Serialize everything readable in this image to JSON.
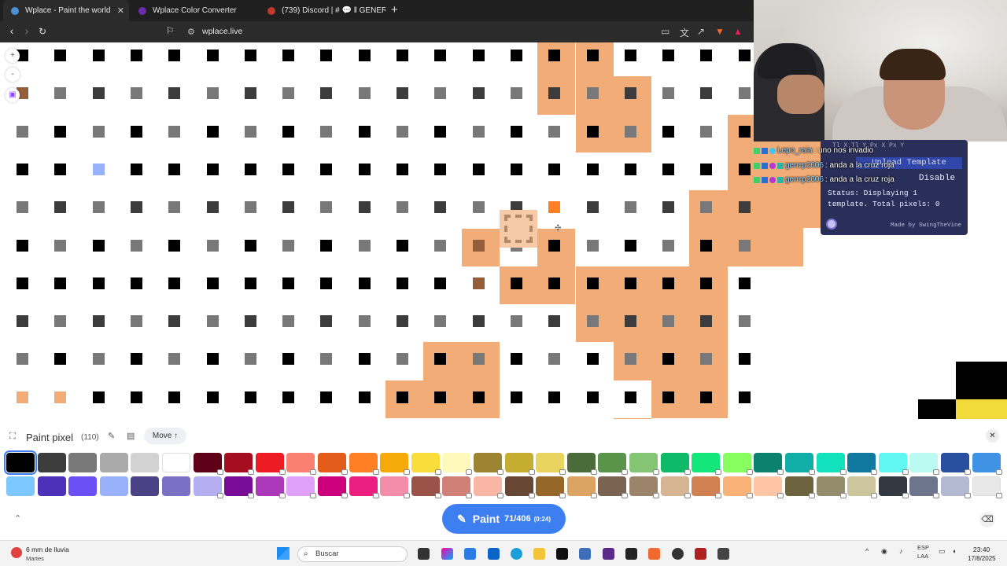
{
  "browser": {
    "tabs": [
      {
        "title": "Wplace - Paint the world",
        "active": true,
        "icon": "globe-icon"
      },
      {
        "title": "Wplace Color Converter",
        "active": false,
        "icon": "purple-dot-icon"
      },
      {
        "title": "(739) Discord | # 💬 ‖ GENERAL | Garg…",
        "active": false,
        "icon": "discord-icon"
      }
    ],
    "new_tab": "+",
    "url": "wplace.live"
  },
  "template_panel": {
    "coords_header": "Tl X   Tl Y   Px X   Px Y",
    "upload_label": "Upload Template",
    "disable_label": "Disable",
    "status_text": "Status: Displaying 1 template. Total pixels: 0",
    "made_by": "Made by SwingTheVine"
  },
  "chat": [
    {
      "user": "Lepo_raia",
      "message": ": uno nos invadio"
    },
    {
      "user": "gerrrp2606",
      "message": ": anda a la cruz roja"
    },
    {
      "user": "gerrrp2606",
      "message": ": anda a la cruz roja"
    }
  ],
  "paint_panel": {
    "title": "Paint pixel",
    "count": "(110)",
    "move_label": "Move ↑",
    "paint_label": "Paint",
    "paint_count": "71/406",
    "paint_time": "(0:24)"
  },
  "palette": {
    "row1": [
      "#000000",
      "#3c3c3c",
      "#787878",
      "#aaaaaa",
      "#d2d2d2",
      "#ffffff",
      "#600018",
      "#a50e1e",
      "#ed1c24",
      "#fa8072",
      "#e45c1a",
      "#ff7f27",
      "#f6aa09",
      "#f9dd3b",
      "#fffabc",
      "#9c8431",
      "#c5ad31",
      "#e8d45f",
      "#4a6b3a",
      "#5a944a",
      "#84c573",
      "#0eb968",
      "#13e67b",
      "#87ff5e",
      "#0c816e",
      "#10aea6",
      "#13e1be",
      "#0f799f",
      "#60f7f2",
      "#bbfaf2",
      "#28509e",
      "#4093e4"
    ],
    "row2": [
      "#7dc7ff",
      "#4d31b8",
      "#6b50f6",
      "#99b1fb",
      "#4a4284",
      "#7a71c4",
      "#b5aef1",
      "#780c99",
      "#aa38b9",
      "#e09ff9",
      "#cb007a",
      "#ec1f80",
      "#f38da9",
      "#9b5249",
      "#d18078",
      "#fab6a4",
      "#684634",
      "#95682a",
      "#dba463",
      "#7b6352",
      "#9c846b",
      "#d6b594",
      "#d18051",
      "#f8b277",
      "#ffc5a5",
      "#6d643f",
      "#948c6b",
      "#cdc59e",
      "#333941",
      "#6d758d",
      "#b3b9d1",
      "#e8e8e8"
    ]
  },
  "taskbar": {
    "weather_line1": "6 mm de lluvia",
    "weather_line2": "Martes",
    "search_placeholder": "Buscar",
    "lang_line1": "ESP",
    "lang_line2": "LAA",
    "time": "23:40",
    "date": "17/8/2025"
  },
  "colors": {
    "orange": "#f2ac78",
    "accent_blue": "#3d7ff1"
  }
}
